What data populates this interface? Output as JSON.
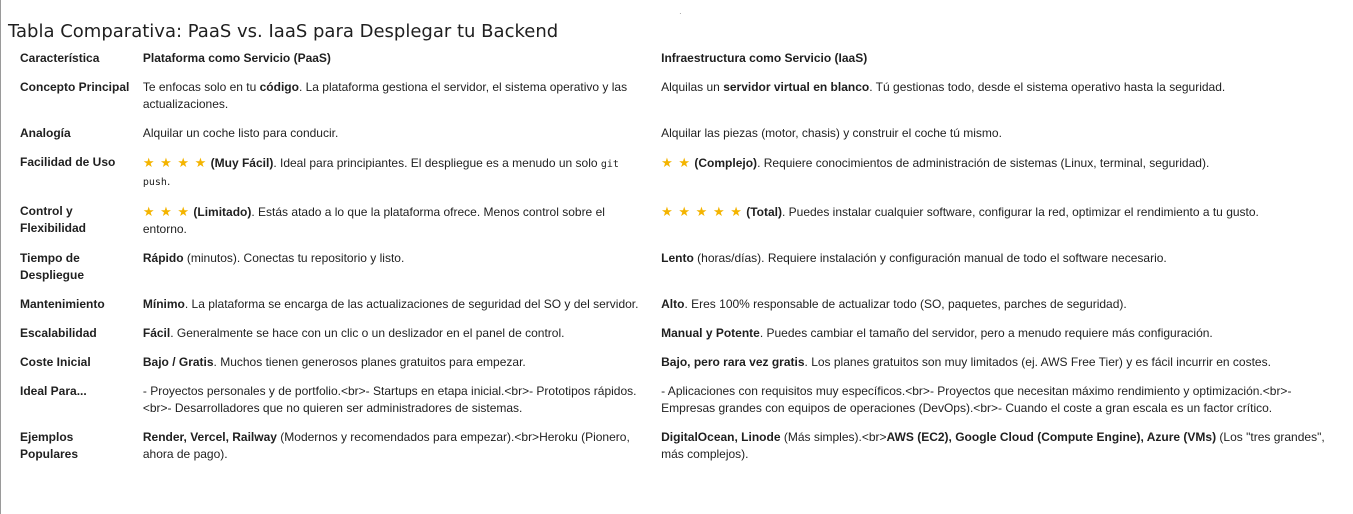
{
  "title": "Tabla Comparativa: PaaS vs. IaaS para Desplegar tu Backend",
  "star_glyph": "★",
  "headers": [
    "Característica",
    "Plataforma como Servicio (PaaS)",
    "Infraestructura como Servicio (IaaS)"
  ],
  "rows": [
    {
      "feature": "Concepto Principal",
      "paas": [
        {
          "t": "Te enfocas solo en tu "
        },
        {
          "b": "código"
        },
        {
          "t": ". La plataforma gestiona el servidor, el sistema operativo y las actualizaciones."
        }
      ],
      "iaas": [
        {
          "t": "Alquilas un "
        },
        {
          "b": "servidor virtual en blanco"
        },
        {
          "t": ". Tú gestionas todo, desde el sistema operativo hasta la seguridad."
        }
      ]
    },
    {
      "feature": "Analogía",
      "paas": [
        {
          "t": "Alquilar un coche listo para conducir."
        }
      ],
      "iaas": [
        {
          "t": "Alquilar las piezas (motor, chasis) y construir el coche tú mismo."
        }
      ]
    },
    {
      "feature": "Facilidad de Uso",
      "paas": [
        {
          "stars": 4
        },
        {
          "b": " (Muy Fácil)"
        },
        {
          "t": ". Ideal para principiantes. El despliegue es a menudo un solo "
        },
        {
          "code": "git push"
        },
        {
          "t": "."
        }
      ],
      "iaas": [
        {
          "stars": 2
        },
        {
          "b": " (Complejo)"
        },
        {
          "t": ". Requiere conocimientos de administración de sistemas (Linux, terminal, seguridad)."
        }
      ]
    },
    {
      "feature": "Control y Flexibilidad",
      "paas": [
        {
          "stars": 3
        },
        {
          "b": " (Limitado)"
        },
        {
          "t": ". Estás atado a lo que la plataforma ofrece. Menos control sobre el entorno."
        }
      ],
      "iaas": [
        {
          "stars": 5
        },
        {
          "b": " (Total)"
        },
        {
          "t": ". Puedes instalar cualquier software, configurar la red, optimizar el rendimiento a tu gusto."
        }
      ]
    },
    {
      "feature": "Tiempo de Despliegue",
      "paas": [
        {
          "b": "Rápido"
        },
        {
          "t": " (minutos). Conectas tu repositorio y listo."
        }
      ],
      "iaas": [
        {
          "b": "Lento"
        },
        {
          "t": " (horas/días). Requiere instalación y configuración manual de todo el software necesario."
        }
      ]
    },
    {
      "feature": "Mantenimiento",
      "paas": [
        {
          "b": "Mínimo"
        },
        {
          "t": ". La plataforma se encarga de las actualizaciones de seguridad del SO y del servidor."
        }
      ],
      "iaas": [
        {
          "b": "Alto"
        },
        {
          "t": ". Eres 100% responsable de actualizar todo (SO, paquetes, parches de seguridad)."
        }
      ]
    },
    {
      "feature": "Escalabilidad",
      "paas": [
        {
          "b": "Fácil"
        },
        {
          "t": ". Generalmente se hace con un clic o un deslizador en el panel de control."
        }
      ],
      "iaas": [
        {
          "b": "Manual y Potente"
        },
        {
          "t": ". Puedes cambiar el tamaño del servidor, pero a menudo requiere más configuración."
        }
      ]
    },
    {
      "feature": "Coste Inicial",
      "paas": [
        {
          "b": "Bajo / Gratis"
        },
        {
          "t": ". Muchos tienen generosos planes gratuitos para empezar."
        }
      ],
      "iaas": [
        {
          "b": "Bajo, pero rara vez gratis"
        },
        {
          "t": ". Los planes gratuitos son muy limitados (ej. AWS Free Tier) y es fácil incurrir en costes."
        }
      ]
    },
    {
      "feature": "Ideal Para...",
      "paas": [
        {
          "t": "- Proyectos personales y de portfolio.<br>- Startups en etapa inicial.<br>- Prototipos rápidos.<br>- Desarrolladores que no quieren ser administradores de sistemas."
        }
      ],
      "iaas": [
        {
          "t": "- Aplicaciones con requisitos muy específicos.<br>- Proyectos que necesitan máximo rendimiento y optimización.<br>- Empresas grandes con equipos de operaciones (DevOps).<br>- Cuando el coste a gran escala es un factor crítico."
        }
      ]
    },
    {
      "feature": "Ejemplos Populares",
      "paas": [
        {
          "b": "Render, Vercel, Railway"
        },
        {
          "t": " (Modernos y recomendados para empezar).<br>Heroku (Pionero, ahora de pago)."
        }
      ],
      "iaas": [
        {
          "b": "DigitalOcean, Linode"
        },
        {
          "t": " (Más simples).<br>"
        },
        {
          "b": "AWS (EC2), Google Cloud (Compute Engine), Azure (VMs)"
        },
        {
          "t": " (Los \"tres grandes\", más complejos)."
        }
      ]
    }
  ]
}
